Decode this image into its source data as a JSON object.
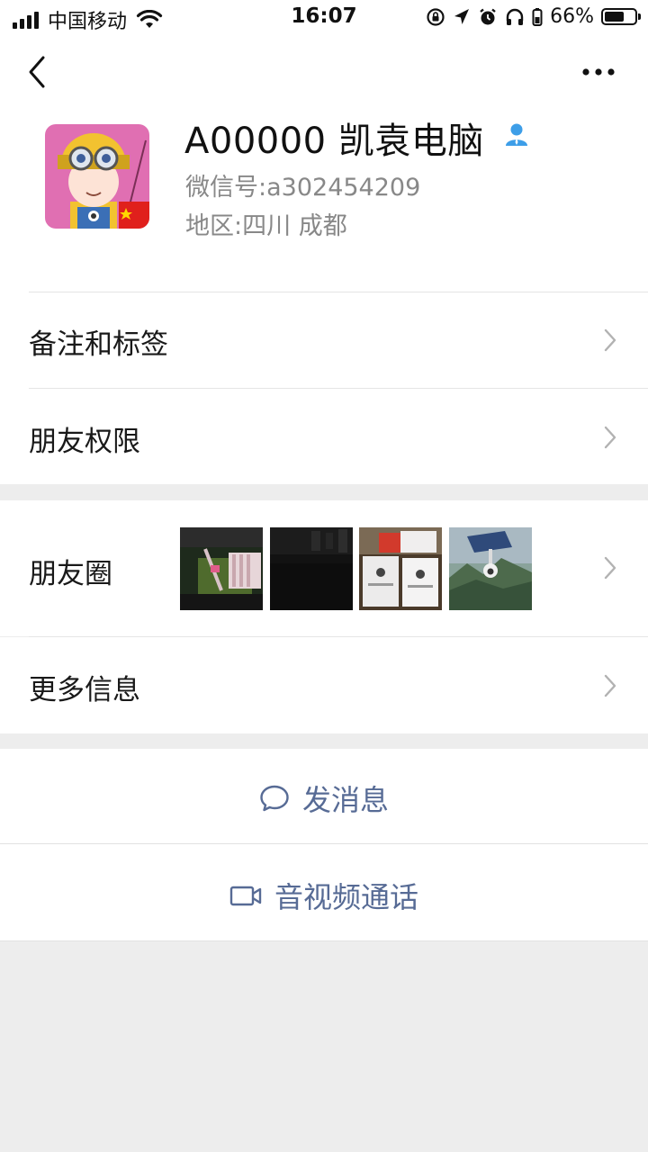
{
  "status_bar": {
    "carrier": "中国移动",
    "time": "16:07",
    "battery": "66%",
    "battery_level": 0.66
  },
  "profile": {
    "name": "A00000 凯袁电脑",
    "wechat_id_label": "微信号:",
    "wechat_id": "a302454209",
    "region_label": "地区:",
    "region": "四川 成都"
  },
  "menu": {
    "remark_tags": "备注和标签",
    "friend_permissions": "朋友权限",
    "moments": "朋友圈",
    "more_info": "更多信息"
  },
  "actions": {
    "send_message": "发消息",
    "video_call": "音视频通话"
  },
  "colors": {
    "link_blue": "#576b95",
    "icon_blue": "#4a90d9",
    "background": "#ededed"
  },
  "icons": {
    "back": "chevron-left-icon",
    "more": "more-dots-icon",
    "contact": "contact-person-icon",
    "chevron": "chevron-right-icon",
    "message": "chat-bubble-icon",
    "video": "video-camera-icon"
  }
}
